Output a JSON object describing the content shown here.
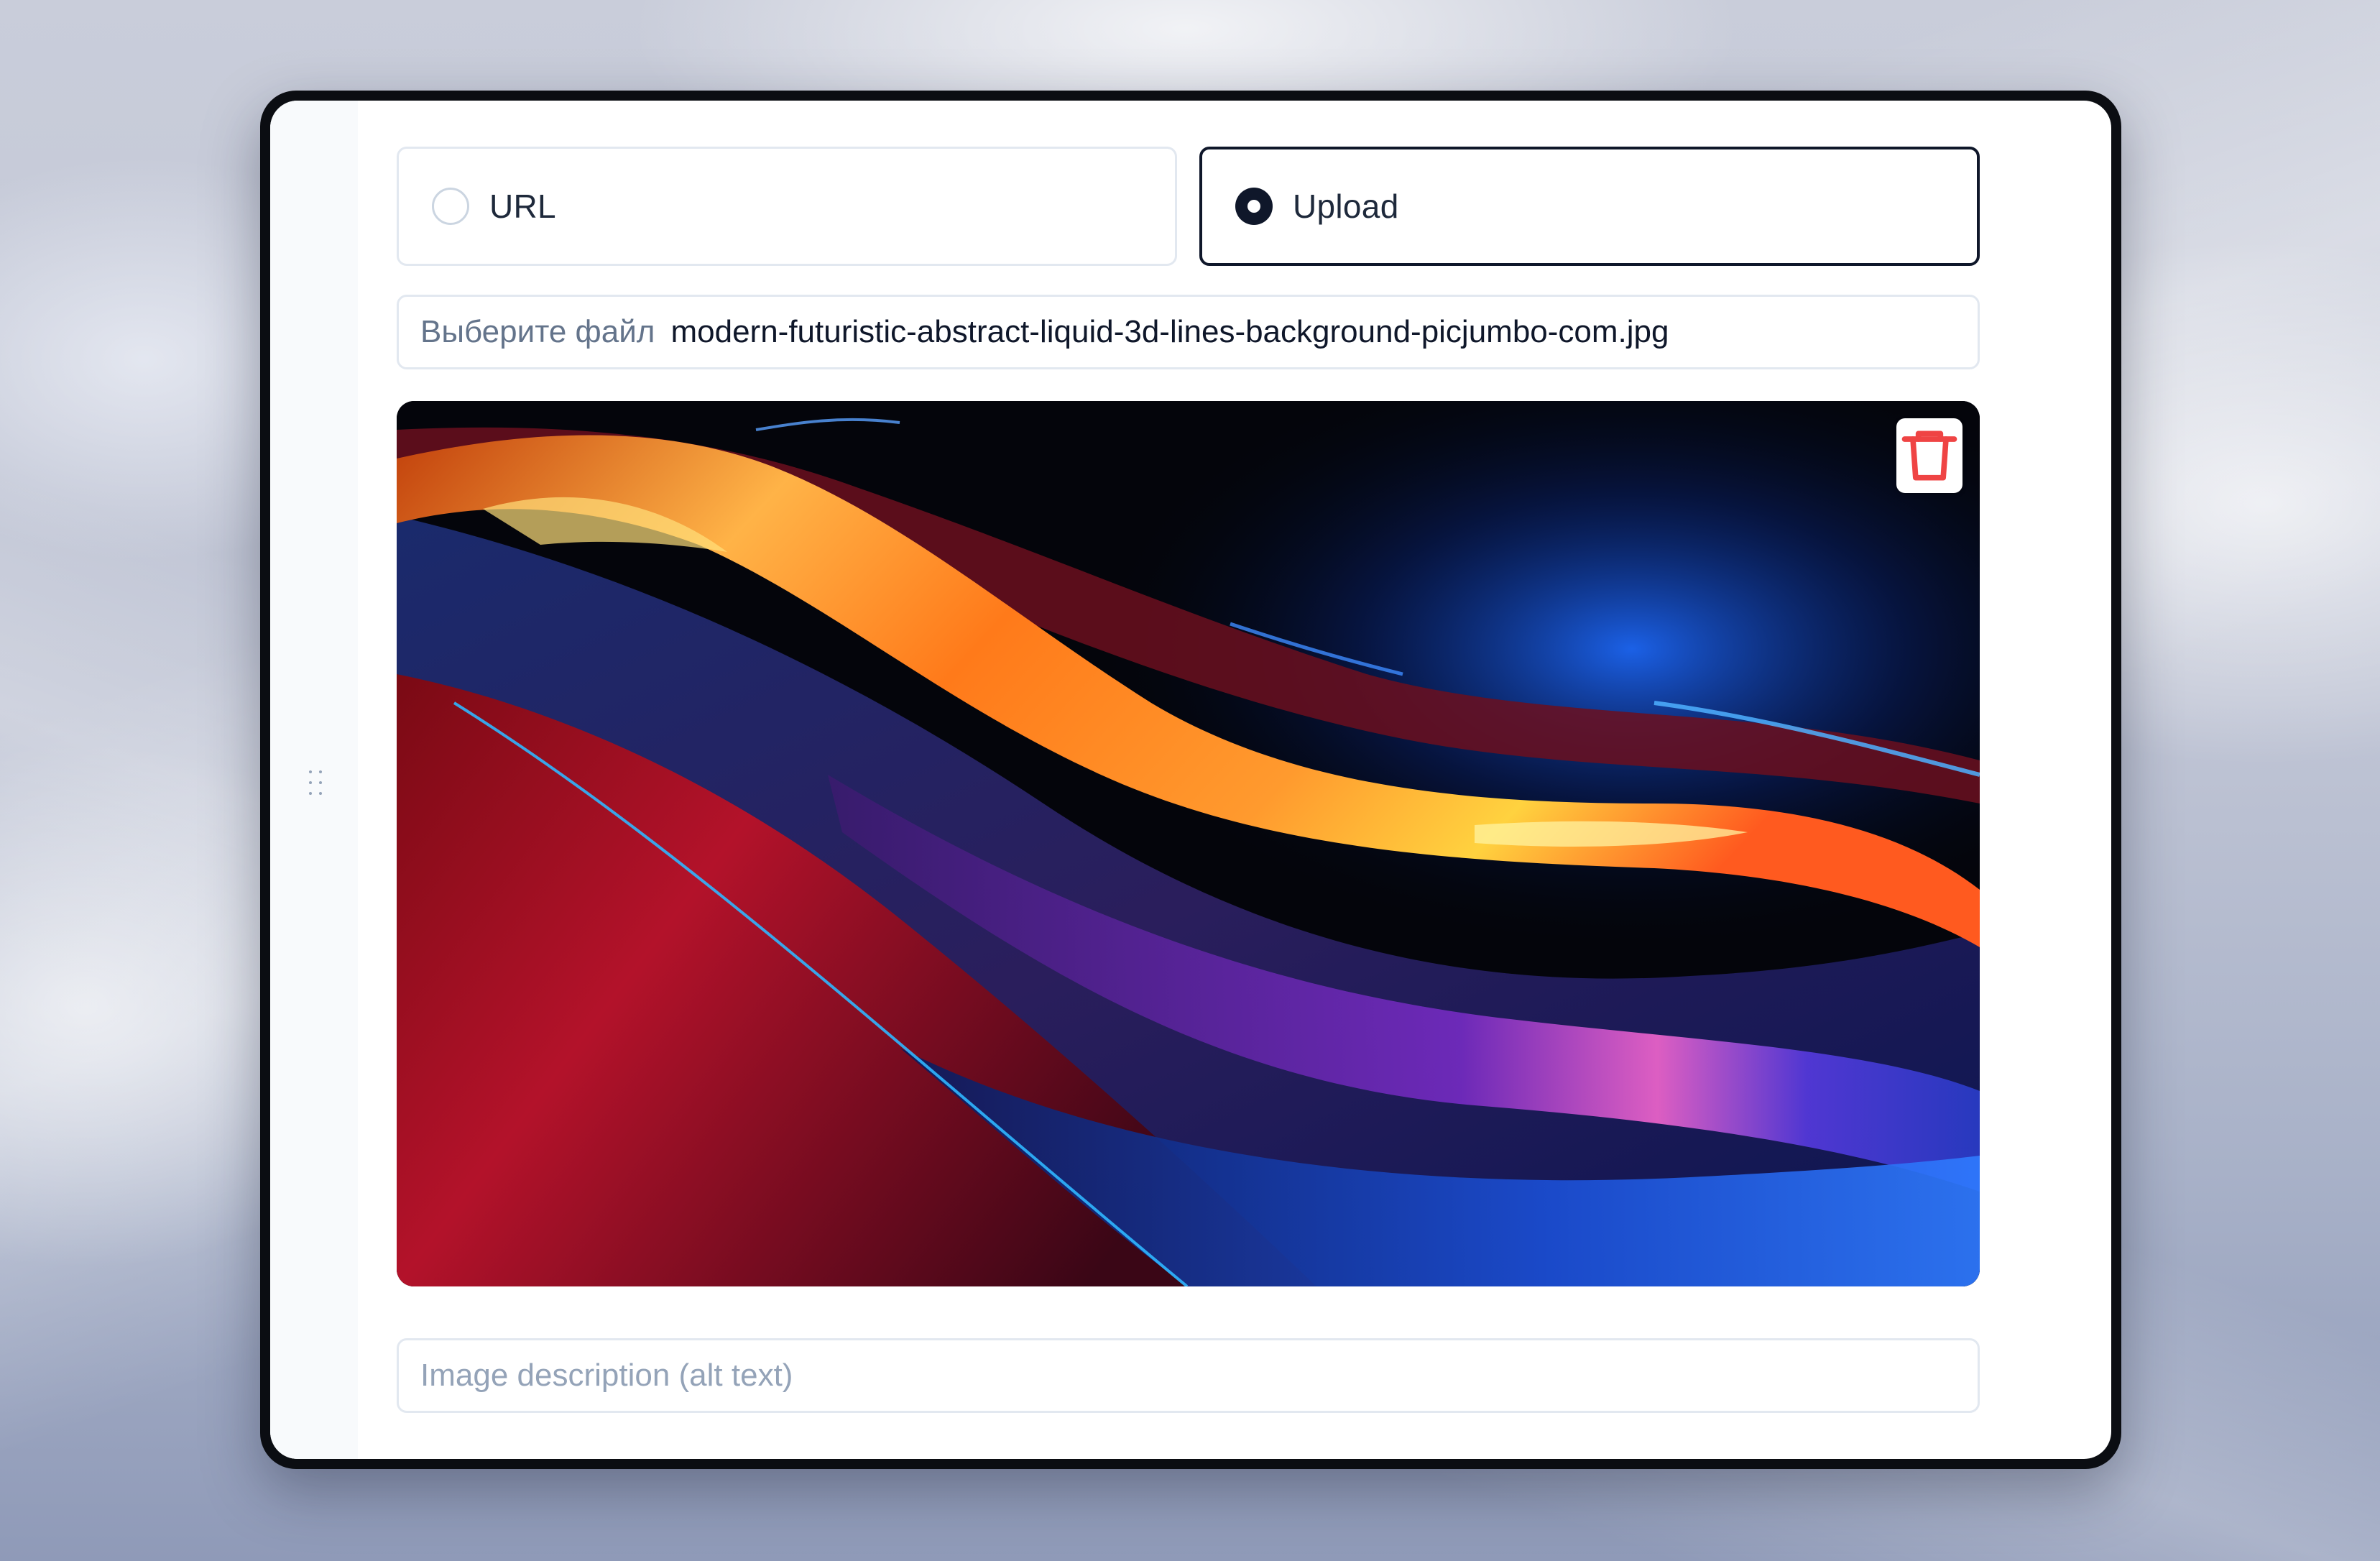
{
  "source_toggle": {
    "options": [
      {
        "label": "URL",
        "selected": false
      },
      {
        "label": "Upload",
        "selected": true
      }
    ]
  },
  "file_input": {
    "button_label": "Выберите файл",
    "file_name": "modern-futuristic-abstract-liquid-3d-lines-background-picjumbo-com.jpg"
  },
  "preview": {
    "delete_icon": "trash-icon",
    "delete_color": "#ef4444"
  },
  "alt_text": {
    "placeholder": "Image description (alt text)",
    "value": ""
  },
  "colors": {
    "selected_border": "#0f172a",
    "input_border": "#e2e8f0",
    "muted_text": "#64748b"
  }
}
